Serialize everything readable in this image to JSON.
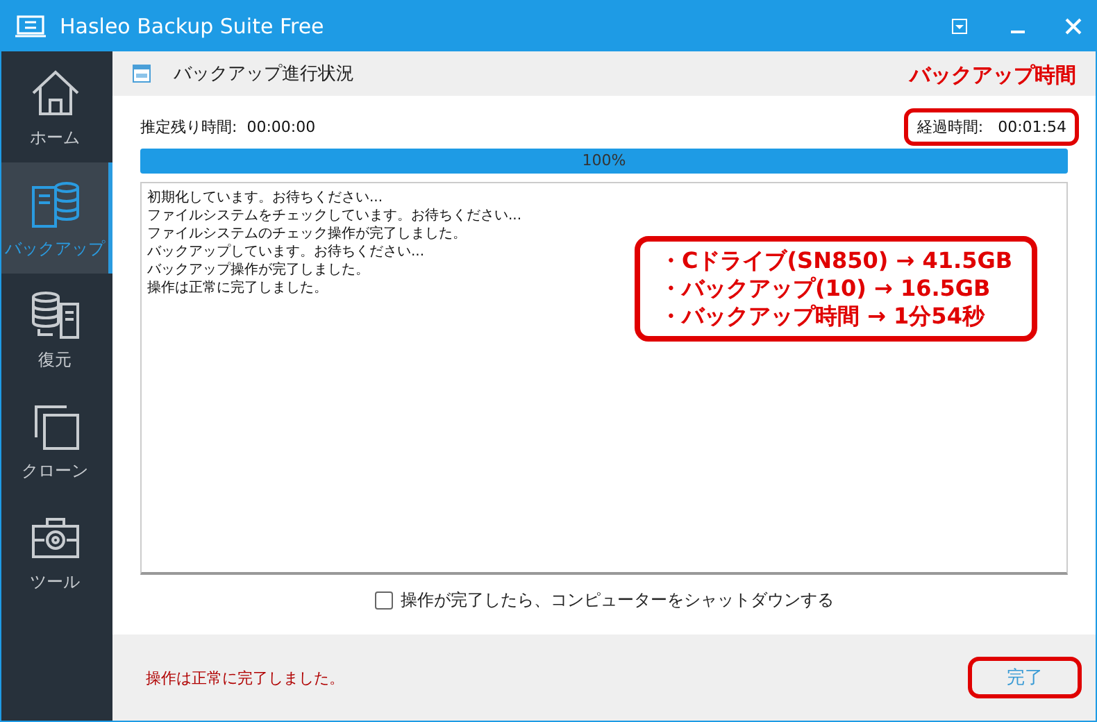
{
  "window": {
    "title": "Hasleo Backup Suite Free"
  },
  "sidebar": {
    "items": [
      {
        "label": "ホーム",
        "kind": "home",
        "selected": false
      },
      {
        "label": "バックアップ",
        "kind": "backup",
        "selected": true
      },
      {
        "label": "復元",
        "kind": "restore",
        "selected": false
      },
      {
        "label": "クローン",
        "kind": "clone",
        "selected": false
      },
      {
        "label": "ツール",
        "kind": "tools",
        "selected": false
      }
    ]
  },
  "header": {
    "title": "バックアップ進行状況"
  },
  "remaining": {
    "label": "推定残り時間:",
    "value": "00:00:00"
  },
  "elapsed": {
    "label": "経過時間:",
    "value": "00:01:54",
    "highlighted": true
  },
  "progress": {
    "level": 1,
    "reading": "100%"
  },
  "log": [
    "初期化しています。お待ちください...",
    "ファイルシステムをチェックしています。お待ちください...",
    "ファイルシステムのチェック操作が完了しました。",
    "バックアップしています。お待ちください...",
    "バックアップ操作が完了しました。",
    "操作は正常に完了しました。"
  ],
  "shutdown": {
    "label": "操作が完了したら、コンピューターをシャットダウンする",
    "checked": false
  },
  "status": "操作は正常に完了しました。",
  "finish_button": {
    "label": "完了",
    "highlighted": true
  },
  "annotations": {
    "heading": "バックアップ時間",
    "notes": [
      "・Cドライブ(SN850) → 41.5GB",
      "・バックアップ(10) → 16.5GB",
      "・バックアップ時間 → 1分54秒"
    ]
  }
}
